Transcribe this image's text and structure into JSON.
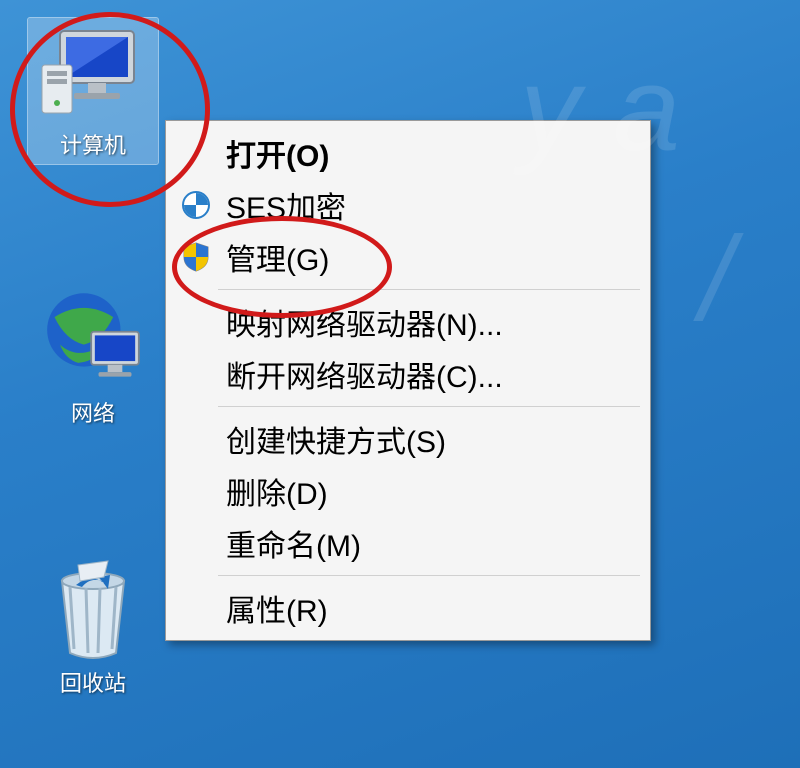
{
  "desktop": {
    "icons": {
      "computer": {
        "label": "计算机"
      },
      "network": {
        "label": "网络"
      },
      "recycle": {
        "label": "回收站"
      }
    }
  },
  "context_menu": {
    "open": "打开(O)",
    "ses": "SES加密",
    "manage": "管理(G)",
    "map_drive": "映射网络驱动器(N)...",
    "disconnect_drive": "断开网络驱动器(C)...",
    "create_shortcut": "创建快捷方式(S)",
    "delete": "删除(D)",
    "rename": "重命名(M)",
    "properties": "属性(R)"
  }
}
